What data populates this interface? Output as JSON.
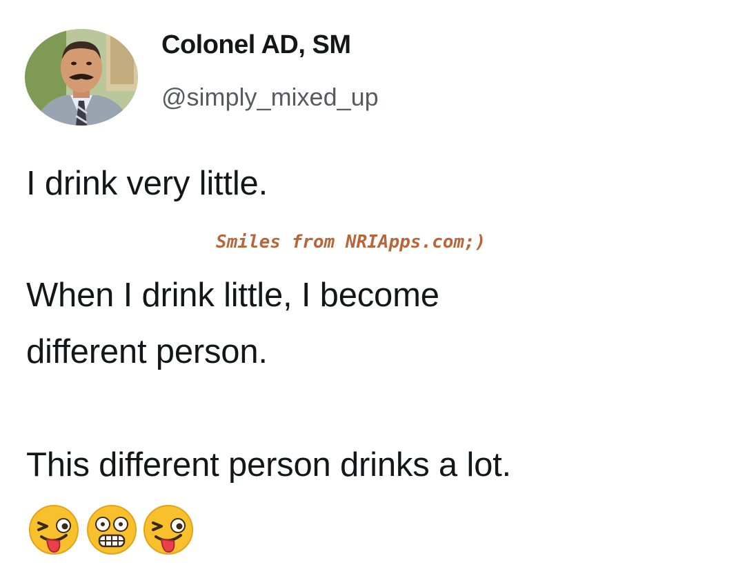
{
  "author": {
    "display_name": "Colonel AD, SM",
    "handle": "@simply_mixed_up"
  },
  "tweet": {
    "line_1": "I drink very little.",
    "line_2": "When I drink little, I become",
    "line_3": "different person.",
    "line_4": "This different person drinks a lot."
  },
  "watermark": {
    "text": "Smiles from NRIApps.com;)"
  },
  "emojis": [
    "zany-face",
    "grimacing-dizzy-face",
    "zany-face"
  ],
  "colors": {
    "text": "#14171a",
    "handle": "#555b61",
    "watermark": "#b8653a",
    "emoji_fill": "#f9c02e"
  }
}
